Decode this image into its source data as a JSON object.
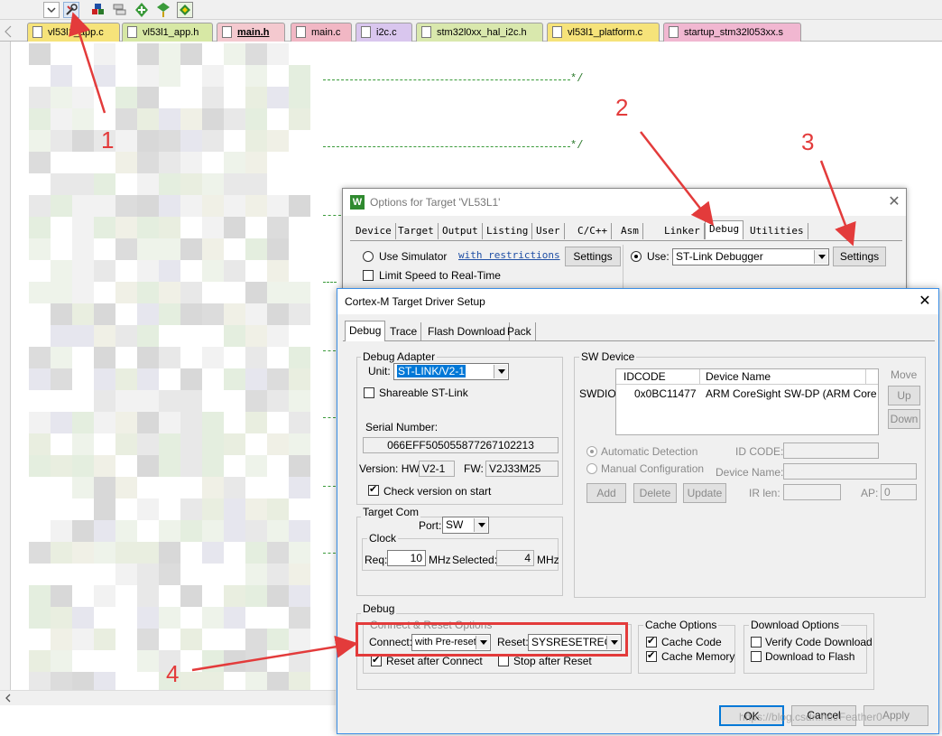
{
  "toolbar": {
    "icons": [
      "dropdown-arrow-icon",
      "options-for-target-icon",
      "manage-project-icon",
      "layers-icon",
      "multi-project-icon",
      "pack-installer-icon",
      "select-packs-icon"
    ]
  },
  "file_tabs": [
    {
      "label": "vl53l1_app.c",
      "color": "#f6e37a",
      "active": false
    },
    {
      "label": "vl53l1_app.h",
      "color": "#d7e8a5",
      "active": false
    },
    {
      "label": "main.h",
      "color": "#f4c9cf",
      "active": true
    },
    {
      "label": "main.c",
      "color": "#f1b7c4",
      "active": false
    },
    {
      "label": "i2c.c",
      "color": "#d9c6ee",
      "active": false
    },
    {
      "label": "stm32l0xx_hal_i2c.h",
      "color": "#d9e8ad",
      "active": false
    },
    {
      "label": "vl53l1_platform.c",
      "color": "#f6e37a",
      "active": false
    },
    {
      "label": "startup_stm32l053xx.s",
      "color": "#f1b7d1",
      "active": false
    }
  ],
  "editor": {
    "comment_end_1": "*/",
    "comment_end_2": "*/"
  },
  "options_dialog": {
    "title": "Options for Target 'VL53L1'",
    "tabs": [
      "Device",
      "Target",
      "Output",
      "Listing",
      "User",
      "C/C++",
      "Asm",
      "Linker",
      "Debug",
      "Utilities"
    ],
    "active_tab": "Debug",
    "use_simulator": "Use Simulator",
    "with_restrictions": "with restrictions",
    "settings_left": "Settings",
    "limit_speed": "Limit Speed to Real-Time",
    "use_label": "Use:",
    "debugger": "ST-Link Debugger",
    "settings_right": "Settings"
  },
  "driver_dialog": {
    "title": "Cortex-M Target Driver Setup",
    "tabs": [
      "Debug",
      "Trace",
      "Flash Download",
      "Pack"
    ],
    "debug_adapter": {
      "group": "Debug Adapter",
      "unit_label": "Unit:",
      "unit_value": "ST-LINK/V2-1",
      "shareable": "Shareable ST-Link",
      "serial_label": "Serial Number:",
      "serial_value": "066EFF505055877267102213",
      "version_label": "Version: HW:",
      "hw_value": "V2-1",
      "fw_label": "FW:",
      "fw_value": "V2J33M25",
      "check_version": "Check version on start"
    },
    "sw_device": {
      "group": "SW Device",
      "col_idcode": "IDCODE",
      "col_name": "Device Name",
      "swdio": "SWDIO",
      "idcode": "0x0BC11477",
      "device_name": "ARM CoreSight SW-DP (ARM Core",
      "move": "Move",
      "up": "Up",
      "down": "Down",
      "auto_detect": "Automatic Detection",
      "manual_config": "Manual Configuration",
      "id_code_label": "ID CODE:",
      "device_name_label": "Device Name:",
      "add": "Add",
      "delete": "Delete",
      "update": "Update",
      "ir_len_label": "IR len:",
      "ap_label": "AP:",
      "ap_value": "0"
    },
    "target_com": {
      "group": "Target Com",
      "port_label": "Port:",
      "port_value": "SW",
      "clock_group": "Clock",
      "req_label": "Req:",
      "req_value": "10",
      "mhz1": "MHz",
      "selected_label": "Selected:",
      "selected_value": "4",
      "mhz2": "MHz"
    },
    "debug": {
      "group": "Debug",
      "connect_reset_group": "Connect & Reset Options",
      "connect_label": "Connect:",
      "connect_value": "with Pre-reset",
      "reset_label": "Reset:",
      "reset_value": "SYSRESETREQ",
      "reset_after_connect": "Reset after Connect",
      "stop_after_reset": "Stop after Reset",
      "cache_group": "Cache Options",
      "cache_code": "Cache Code",
      "cache_memory": "Cache Memory",
      "download_group": "Download Options",
      "verify_code": "Verify Code Download",
      "download_flash": "Download to Flash"
    },
    "ok": "OK",
    "cancel": "Cancel",
    "apply": "Apply"
  },
  "annotations": [
    "1",
    "2",
    "3",
    "4"
  ],
  "watermark": "https://blog.csdn.net/Feather0",
  "colors": {
    "annotation_red": "#e33b3b",
    "selection_blue": "#0078d7"
  }
}
